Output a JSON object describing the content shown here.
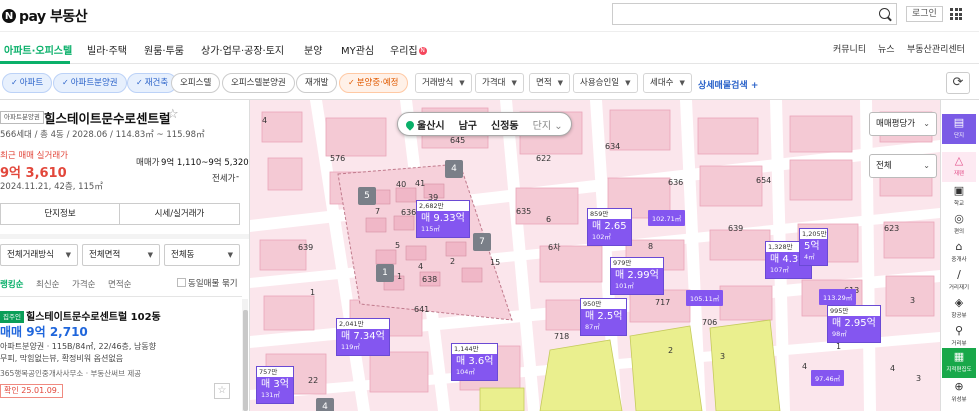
{
  "brand": {
    "n": "N",
    "name": "pay 부동산"
  },
  "search": {
    "value": "",
    "placeholder": ""
  },
  "header": {
    "login": "로그인"
  },
  "nav": {
    "tabs": [
      {
        "label": "아파트·오피스텔"
      },
      {
        "label": "빌라·주택"
      },
      {
        "label": "원룸·투룸"
      },
      {
        "label": "상가·업무·공장·토지"
      },
      {
        "label": "분양"
      },
      {
        "label": "MY관심"
      },
      {
        "label": "우리집"
      }
    ],
    "new_badge": "N",
    "right": [
      "커뮤니티",
      "뉴스",
      "부동산관리센터"
    ]
  },
  "filters": {
    "chips": [
      {
        "label": "아파트",
        "style": "blue"
      },
      {
        "label": "아파트분양권",
        "style": "blue"
      },
      {
        "label": "재건축",
        "style": "blue"
      },
      {
        "label": "오피스텔",
        "style": "plain"
      },
      {
        "label": "오피스텔분양권",
        "style": "plain"
      },
      {
        "label": "재개발",
        "style": "plain"
      },
      {
        "label": "분양중·예정",
        "style": "orange"
      }
    ],
    "check": "✓",
    "dropdowns": [
      "거래방식",
      "가격대",
      "면적",
      "사용승인일",
      "세대수"
    ],
    "detail_search": "상세매물검색",
    "plus": "+"
  },
  "complex": {
    "type_badge": "아파트분양권",
    "name": "힐스테이트문수로센트럴",
    "info": "566세대 / 총 4동 / 2028.06 / 114.83㎡ ~ 115.98㎡",
    "recent_label": "최근 매매 실거래가",
    "recent_price": "9억 3,610",
    "recent_date": "2024.11.21, 42층, 115㎡",
    "sale_label": "매매가",
    "sale_value": "9억 1,110~9억 5,320",
    "jeonse_label": "전세가",
    "jeonse_value": "-",
    "btn_info": "단지정보",
    "btn_price": "시세/실거래가"
  },
  "panel_filters": {
    "trade": "전체거래방식",
    "area": "전체면적",
    "dong": "전체동"
  },
  "sort": {
    "items": [
      "랭킹순",
      "최신순",
      "가격순",
      "면적순"
    ],
    "dedupe": "동일매물 묶기"
  },
  "listing": {
    "owner_badge": "집주인",
    "title": "힐스테이트문수로센트럴 102동",
    "price": "매매 9억 2,710",
    "desc1": "아파트분양권 · 115B/84㎡, 22/46층, 남동향",
    "desc2": "무피, 막힘없는뷰, 확정비워 옵션없음",
    "agent": "365행복공인중개사사무소 · 부동산써브 제공",
    "confirm": "확인 25.01.09.",
    "star": "☆"
  },
  "map": {
    "location": {
      "city": "울산시",
      "gu": "남구",
      "dong": "신정동",
      "complex": "단지"
    },
    "price_type": "매매평당가",
    "all": "전체",
    "markers": [
      {
        "top": "2,682만",
        "price": "매 9.33억",
        "area": "115㎡"
      },
      {
        "top": "859만",
        "price": "매 2.65",
        "area": "102㎡"
      },
      {
        "top": "979만",
        "price": "매 2.99억",
        "area": "101㎡"
      },
      {
        "top": "950만",
        "price": "매 2.5억",
        "area": "87㎡"
      },
      {
        "top": "1,328만",
        "price": "매 4.3억",
        "area": "107㎡"
      },
      {
        "top": "995만",
        "price": "매 2.95억",
        "area": "98㎡"
      },
      {
        "top": "2,041만",
        "price": "매 7.34억",
        "area": "119㎡"
      },
      {
        "top": "1,144만",
        "price": "매 3.6억",
        "area": "104㎡"
      },
      {
        "top": "757만",
        "price": "매 3억",
        "area": "131㎡"
      },
      {
        "top": "1,205만",
        "price": "5억",
        "area": "4㎡"
      }
    ],
    "small_markers": [
      "102.71㎡",
      "105.11㎡",
      "113.29㎡",
      "97.46㎡"
    ],
    "clusters": [
      "4",
      "5",
      "7",
      "1",
      "4"
    ],
    "lot_numbers": [
      "576",
      "639",
      "40",
      "41",
      "39",
      "7",
      "636",
      "5",
      "1",
      "2",
      "4",
      "15",
      "638",
      "622",
      "645",
      "641",
      "1",
      "634",
      "635",
      "6",
      "6차",
      "636",
      "654",
      "639",
      "8",
      "718",
      "717",
      "706",
      "2",
      "3",
      "4",
      "623",
      "613",
      "3",
      "1",
      "4",
      "3",
      "15",
      "22",
      "4",
      "4"
    ]
  },
  "rail": {
    "tools": [
      {
        "icon": "▤",
        "label": "단지",
        "style": "purple"
      },
      {
        "icon": "△",
        "label": "재팬",
        "style": "pink"
      },
      {
        "icon": "▣",
        "label": "학교",
        "style": ""
      },
      {
        "icon": "◎",
        "label": "편의",
        "style": ""
      },
      {
        "icon": "⌂",
        "label": "중개사",
        "style": ""
      },
      {
        "icon": "∕",
        "label": "거리재기",
        "style": ""
      },
      {
        "icon": "◈",
        "label": "항공뷰",
        "style": ""
      },
      {
        "icon": "⚲",
        "label": "거리뷰",
        "style": ""
      },
      {
        "icon": "▦",
        "label": "지적편집도",
        "style": "green"
      },
      {
        "icon": "⊕",
        "label": "위성뷰",
        "style": ""
      }
    ]
  }
}
